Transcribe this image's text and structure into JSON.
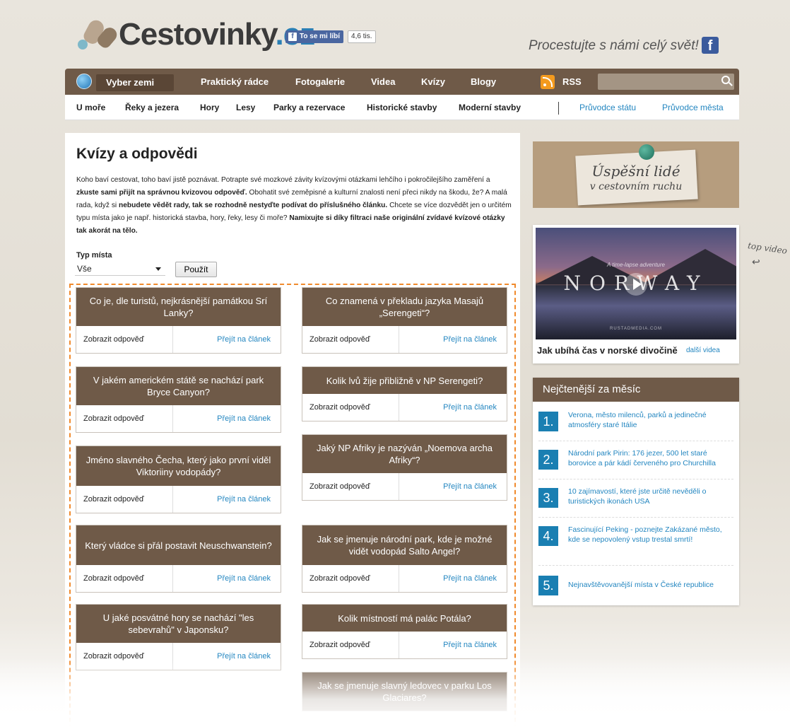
{
  "header": {
    "logo_main": "Cestovinky",
    "logo_tld": ".cz",
    "fb_like_label": "To se mi líbí",
    "fb_like_count": "4,6 tis.",
    "slogan": "Procestujte s námi celý svět!"
  },
  "main_nav": {
    "select_country": "Vyber zemi",
    "items": [
      "Praktický rádce",
      "Fotogalerie",
      "Videa",
      "Kvízy",
      "Blogy"
    ],
    "rss": "RSS",
    "search_placeholder": ""
  },
  "sub_nav": {
    "items": [
      "U moře",
      "Řeky a jezera",
      "Hory",
      "Lesy",
      "Parky a rezervace",
      "Historické stavby",
      "Moderní stavby"
    ],
    "guides": [
      "Průvodce státu",
      "Průvodce města"
    ]
  },
  "content": {
    "title": "Kvízy a odpovědi",
    "intro": {
      "p1": "Koho baví cestovat, toho baví jistě poznávat. Potrapte své mozkové závity kvízovými otázkami lehčího i pokročilejšího zaměření a ",
      "b1": "zkuste sami přijít na správnou kvizovou odpověď.",
      "p2": " Obohatit své zeměpisné a kulturní znalosti není přeci nikdy na škodu, že? A malá rada, když si ",
      "b2": "nebudete vědět rady, tak se rozhodně nestyďte podívat do příslušného článku.",
      "p3": " Chcete se více dozvědět jen o určitém typu místa jako je např. historická stavba, hory, řeky, lesy či moře? ",
      "b3": "Namixujte si díky filtraci naše originální zvídavé kvízové otázky tak akorát na tělo."
    },
    "filter_label": "Typ místa",
    "filter_value": "Vše",
    "apply_button": "Použít"
  },
  "quizzes": {
    "show_answer": "Zobrazit odpověď",
    "go_to_article": "Přejít na článek",
    "left": [
      "Co je, dle turistů, nejkrásnější památkou Srí Lanky?",
      "V jakém americkém státě se nachází park Bryce Canyon?",
      "Jméno slavného Čecha, který jako první viděl Viktoriiny vodopády?",
      "Který vládce si přál postavit Neuschwanstein?",
      "U jaké posvátné hory se nachází \"les sebevrahů\" v Japonsku?"
    ],
    "right": [
      "Co znamená v překladu jazyka Masajů „Serengeti“?",
      "Kolik lvů žije přibližně v NP Serengeti?",
      "Jaký NP Afriky je nazýván „Noemova archa Afriky“?",
      "Jak se jmenuje národní park, kde je možné vidět vodopád Salto Angel?",
      "Kolik místností má palác Potála?",
      "Jak se jmenuje slavný ledovec v parku Los Glaciares?"
    ]
  },
  "sidebar": {
    "promo_line1": "Úspěšní lidé",
    "promo_line2": "v cestovním ruchu",
    "video_overlay_title": "NORWAY",
    "video_overlay_sub": "A time-lapse adventure",
    "video_brand": "RUSTADMEDIA.COM",
    "video_caption": "Jak ubíhá čas v norské divočině",
    "video_more": "další videa",
    "top_video_note": "top video",
    "top_title": "Nejčtenější za měsíc",
    "top_items": [
      {
        "num": "1.",
        "text": "Verona, město milenců, parků a jedinečné atmosféry staré Itálie"
      },
      {
        "num": "2.",
        "text": "Národní park Pirin: 176 jezer, 500 let staré borovice a pár kádí červeného pro Churchilla"
      },
      {
        "num": "3.",
        "text": "10 zajímavostí, které jste určitě nevěděli o turistických ikonách USA"
      },
      {
        "num": "4.",
        "text": "Fascinující Peking - poznejte Zakázané město, kde se nepovolený vstup trestal smrtí!"
      },
      {
        "num": "5.",
        "text": "Nejnavštěvovanější místa v České republice"
      }
    ]
  },
  "colors": {
    "brown": "#6f5a48",
    "accent_blue": "#2386c0",
    "dashed_orange": "#f08a2c"
  }
}
